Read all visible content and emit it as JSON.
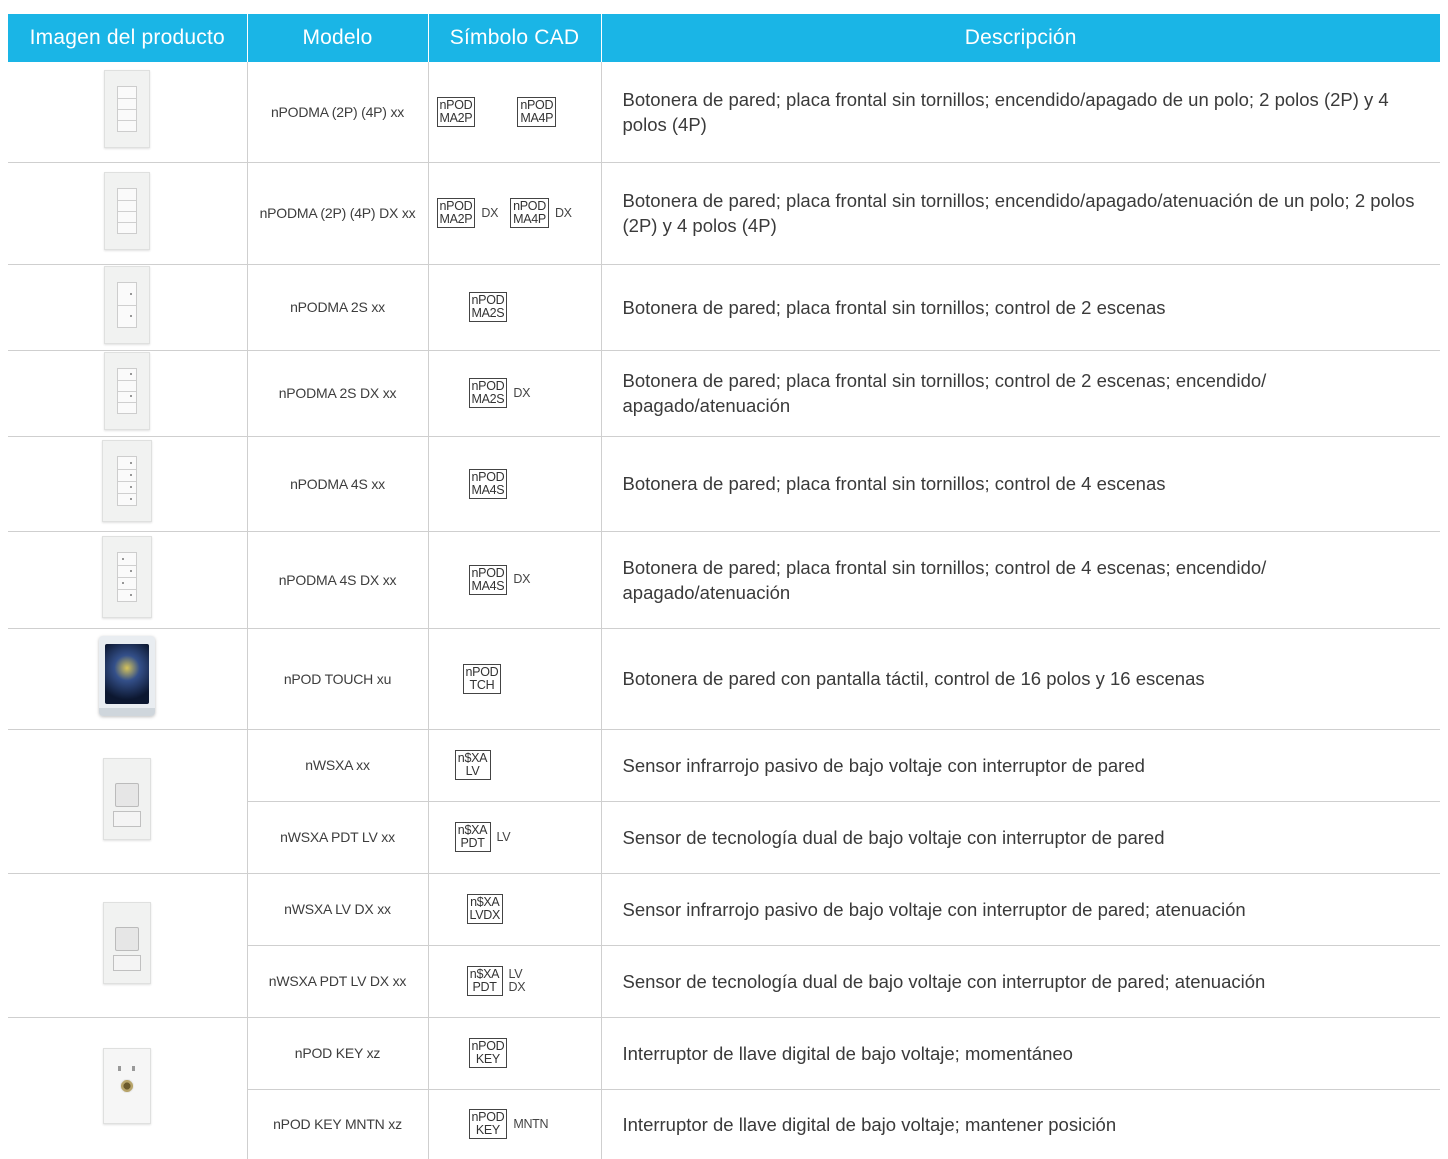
{
  "headers": {
    "image": "Imagen del producto",
    "model": "Modelo",
    "cad": "Símbolo CAD",
    "description": "Descripción"
  },
  "rows": [
    {
      "model": "nPODMA (2P) (4P) xx",
      "cad": [
        [
          "nPOD",
          "MA2P",
          ""
        ],
        [
          "nPOD",
          "MA4P",
          ""
        ]
      ],
      "description": "Botonera de pared; placa frontal sin tornillos; encendido/apagado de un polo; 2 polos (2P) y 4 polos (4P)"
    },
    {
      "model": "nPODMA (2P) (4P) DX xx",
      "cad": [
        [
          "nPOD",
          "MA2P",
          "DX"
        ],
        [
          "nPOD",
          "MA4P",
          "DX"
        ]
      ],
      "description": "Botonera de pared; placa frontal sin tornillos; encendido/apagado/atenuación de un polo; 2 polos (2P) y 4 polos (4P)"
    },
    {
      "model": "nPODMA 2S xx",
      "cad": [
        [
          "nPOD",
          "MA2S",
          ""
        ]
      ],
      "description": "Botonera de pared; placa frontal sin tornillos; control de 2 escenas"
    },
    {
      "model": "nPODMA 2S DX xx",
      "cad": [
        [
          "nPOD",
          "MA2S",
          "DX"
        ]
      ],
      "description": "Botonera de pared; placa frontal sin tornillos; control de 2 escenas; encendido/ apagado/atenuación"
    },
    {
      "model": "nPODMA 4S xx",
      "cad": [
        [
          "nPOD",
          "MA4S",
          ""
        ]
      ],
      "description": "Botonera de pared; placa frontal sin tornillos; control de 4 escenas"
    },
    {
      "model": "nPODMA 4S DX xx",
      "cad": [
        [
          "nPOD",
          "MA4S",
          "DX"
        ]
      ],
      "description": "Botonera de pared; placa frontal sin tornillos; control de 4 escenas; encendido/ apagado/atenuación"
    },
    {
      "model": "nPOD TOUCH xu",
      "cad": [
        [
          "nPOD",
          "TCH",
          ""
        ]
      ],
      "description": "Botonera de pared con pantalla táctil, control de 16 polos y 16 escenas"
    },
    {
      "model": "nWSXA xx",
      "cad": [
        [
          "n$XA",
          "LV",
          ""
        ]
      ],
      "description": "Sensor infrarrojo pasivo de bajo voltaje con interruptor de pared"
    },
    {
      "model": "nWSXA PDT LV xx",
      "cad": [
        [
          "n$XA",
          "PDT",
          "LV"
        ]
      ],
      "description": "Sensor de tecnología dual de bajo voltaje con interruptor de pared"
    },
    {
      "model": "nWSXA LV DX xx",
      "cad": [
        [
          "n$XA",
          "LVDX",
          ""
        ]
      ],
      "description": "Sensor infrarrojo pasivo de bajo voltaje con interruptor de pared; atenuación"
    },
    {
      "model": "nWSXA PDT LV DX xx",
      "cad": [
        [
          "n$XA",
          "PDT",
          "LV DX"
        ]
      ],
      "description": "Sensor de tecnología dual de bajo voltaje con interruptor de pared; atenuación"
    },
    {
      "model": "nPOD KEY xz",
      "cad": [
        [
          "nPOD",
          "KEY",
          ""
        ]
      ],
      "description": "Interruptor de llave digital de bajo voltaje; momentáneo"
    },
    {
      "model": "nPOD KEY MNTN xz",
      "cad": [
        [
          "nPOD",
          "KEY",
          "MNTN"
        ]
      ],
      "description": "Interruptor de llave digital de bajo voltaje; mantener posición"
    }
  ]
}
